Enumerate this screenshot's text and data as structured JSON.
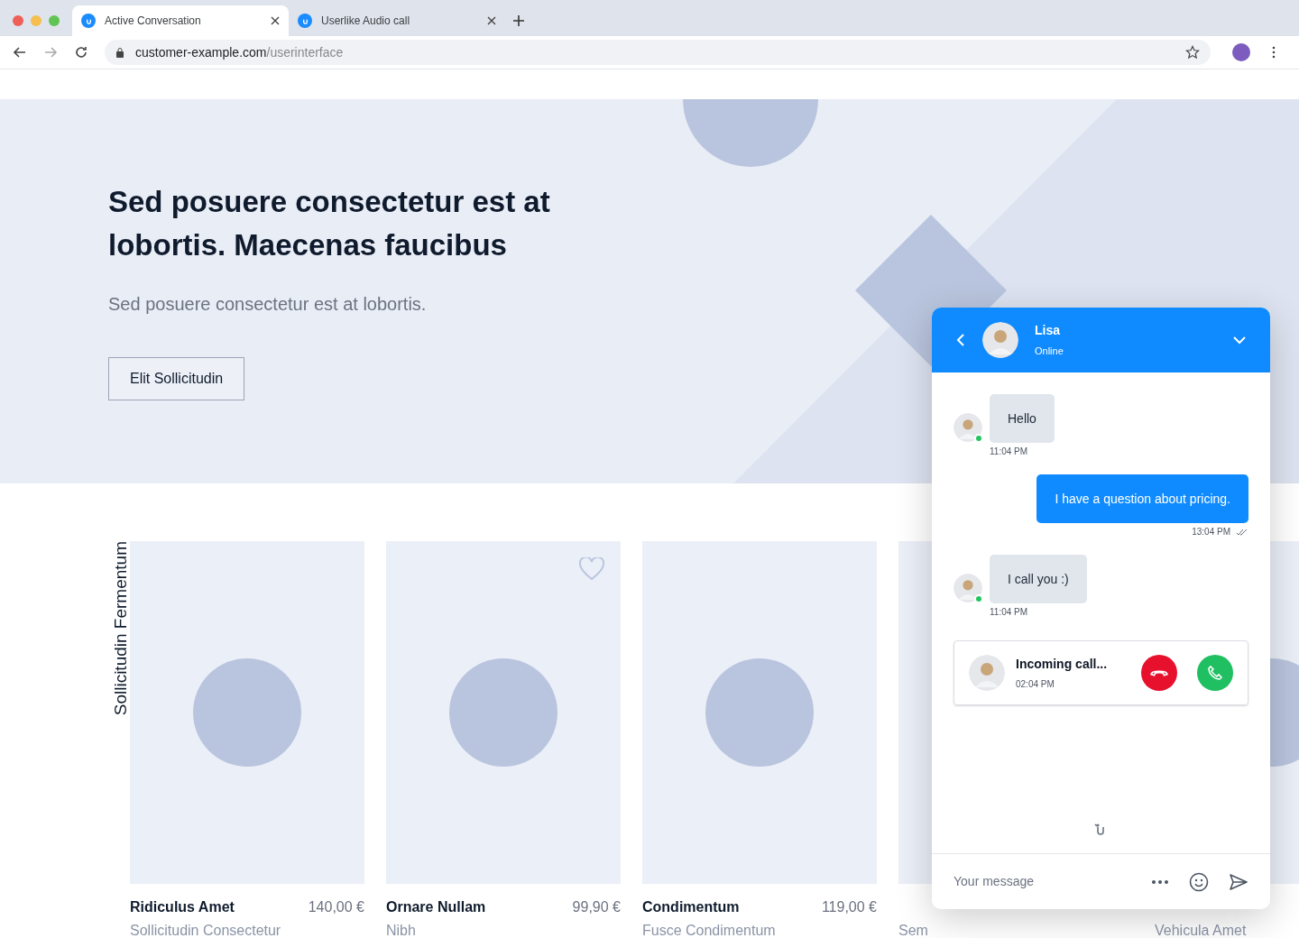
{
  "browser": {
    "tabs": [
      {
        "title": "Active Conversation",
        "selected": true
      },
      {
        "title": "Userlike Audio call",
        "selected": false
      }
    ],
    "url_host": "customer-example.com",
    "url_path": "/userinterface"
  },
  "hero": {
    "title": "Sed posuere consectetur est at lobortis. Maecenas faucibus",
    "subtitle": "Sed posuere consectetur est at lobortis.",
    "button": "Elit Sollicitudin"
  },
  "products": {
    "section_label": "Sollicitudin Fermentum",
    "items": [
      {
        "name": "Ridiculus Amet",
        "price": "140,00 €",
        "subtitle": "Sollicitudin Consectetur",
        "favorite": false
      },
      {
        "name": "Ornare Nullam",
        "price": "99,90 €",
        "subtitle": "Nibh",
        "favorite": true
      },
      {
        "name": "Condimentum",
        "price": "119,00 €",
        "subtitle": "Fusce Condimentum",
        "favorite": false
      },
      {
        "subtitle": "Sem"
      },
      {
        "subtitle": "Vehicula Amet"
      }
    ]
  },
  "chat": {
    "agent": {
      "name": "Lisa",
      "status": "Online"
    },
    "messages": [
      {
        "kind": "incoming",
        "text": "Hello",
        "time": "11:04 PM",
        "online": true
      },
      {
        "kind": "outgoing",
        "text": "I have a question about pricing.",
        "time": "13:04 PM",
        "read": true
      },
      {
        "kind": "incoming",
        "text": "I call you :)",
        "time": "11:04 PM",
        "online": true
      },
      {
        "kind": "call",
        "text": "Incoming call...",
        "time": "02:04 PM"
      }
    ],
    "composer": {
      "placeholder": "Your message"
    }
  }
}
